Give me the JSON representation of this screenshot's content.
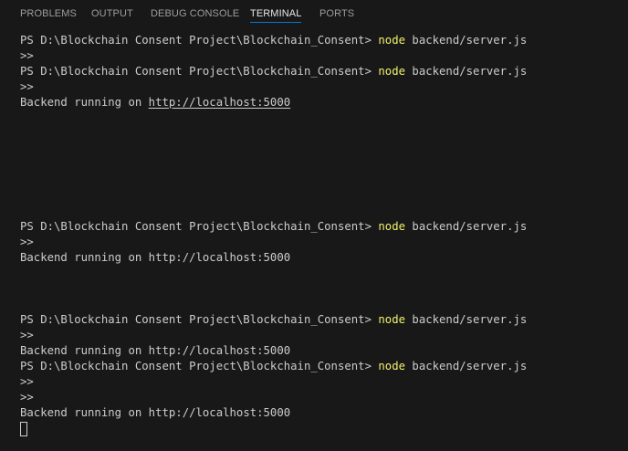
{
  "panel": {
    "tabs": [
      {
        "label": "PROBLEMS",
        "active": false
      },
      {
        "label": "OUTPUT",
        "active": false
      },
      {
        "label": "DEBUG CONSOLE",
        "active": false
      },
      {
        "label": "TERMINAL",
        "active": true
      },
      {
        "label": "PORTS",
        "active": false
      }
    ]
  },
  "terminal": {
    "prompt": "PS D:\\Blockchain Consent Project\\Blockchain_Consent> ",
    "command_exe": "node",
    "command_args": " backend/server.js",
    "continuation": ">>",
    "output_prefix": "Backend running on ",
    "output_url": "http://localhost:5000"
  },
  "colors": {
    "background": "#181818",
    "text": "#cccccc",
    "command": "#f1f16d",
    "active_tab_underline": "#0078d4"
  }
}
